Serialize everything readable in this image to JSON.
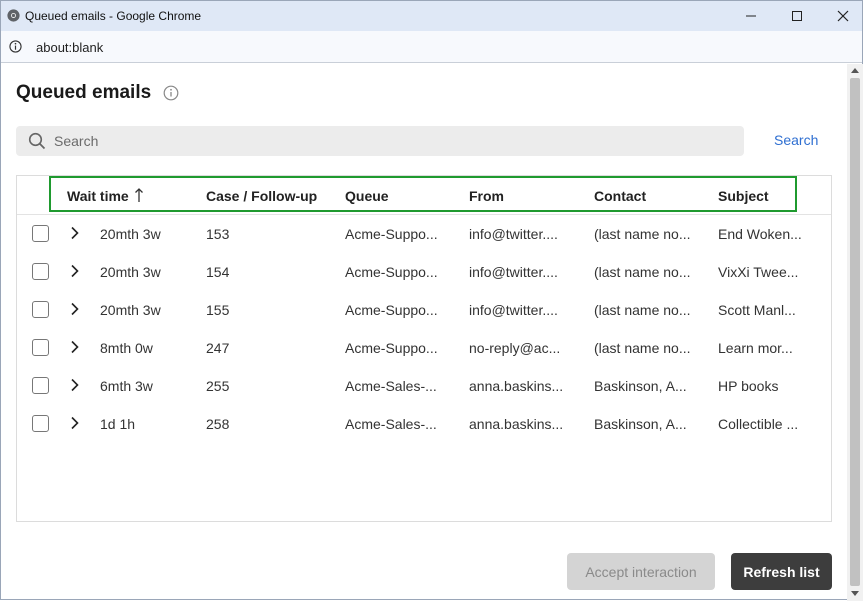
{
  "window": {
    "title": "Queued emails - Google Chrome",
    "url": "about:blank"
  },
  "page": {
    "title": "Queued emails"
  },
  "search": {
    "placeholder": "Search",
    "link_label": "Search"
  },
  "table": {
    "columns": [
      "Wait time",
      "Case / Follow-up",
      "Queue",
      "From",
      "Contact",
      "Subject"
    ],
    "sort": {
      "column": "Wait time",
      "direction": "ascending"
    },
    "rows": [
      {
        "wait": "20mth 3w",
        "case": "153",
        "queue": "Acme-Suppo...",
        "from": "info@twitter....",
        "contact": "(last name no...",
        "subject": "End Woken..."
      },
      {
        "wait": "20mth 3w",
        "case": "154",
        "queue": "Acme-Suppo...",
        "from": "info@twitter....",
        "contact": "(last name no...",
        "subject": "VixXi Twee..."
      },
      {
        "wait": "20mth 3w",
        "case": "155",
        "queue": "Acme-Suppo...",
        "from": "info@twitter....",
        "contact": "(last name no...",
        "subject": "Scott Manl..."
      },
      {
        "wait": "8mth 0w",
        "case": "247",
        "queue": "Acme-Suppo...",
        "from": "no-reply@ac...",
        "contact": "(last name no...",
        "subject": "Learn mor..."
      },
      {
        "wait": "6mth 3w",
        "case": "255",
        "queue": "Acme-Sales-...",
        "from": "anna.baskins...",
        "contact": "Baskinson, A...",
        "subject": "HP books"
      },
      {
        "wait": "1d 1h",
        "case": "258",
        "queue": "Acme-Sales-...",
        "from": "anna.baskins...",
        "contact": "Baskinson, A...",
        "subject": "Collectible ..."
      }
    ]
  },
  "actions": {
    "accept_label": "Accept interaction",
    "refresh_label": "Refresh list"
  },
  "colors": {
    "link": "#2f6fd1",
    "highlight_border": "#1f9a2f",
    "primary_button": "#3d3d3d",
    "disabled_button": "#d4d4d4"
  },
  "icons": [
    "chrome-icon",
    "minimize-icon",
    "maximize-icon",
    "close-icon",
    "info-icon",
    "search-icon",
    "sort-up-arrow-icon",
    "chevron-right-icon"
  ]
}
